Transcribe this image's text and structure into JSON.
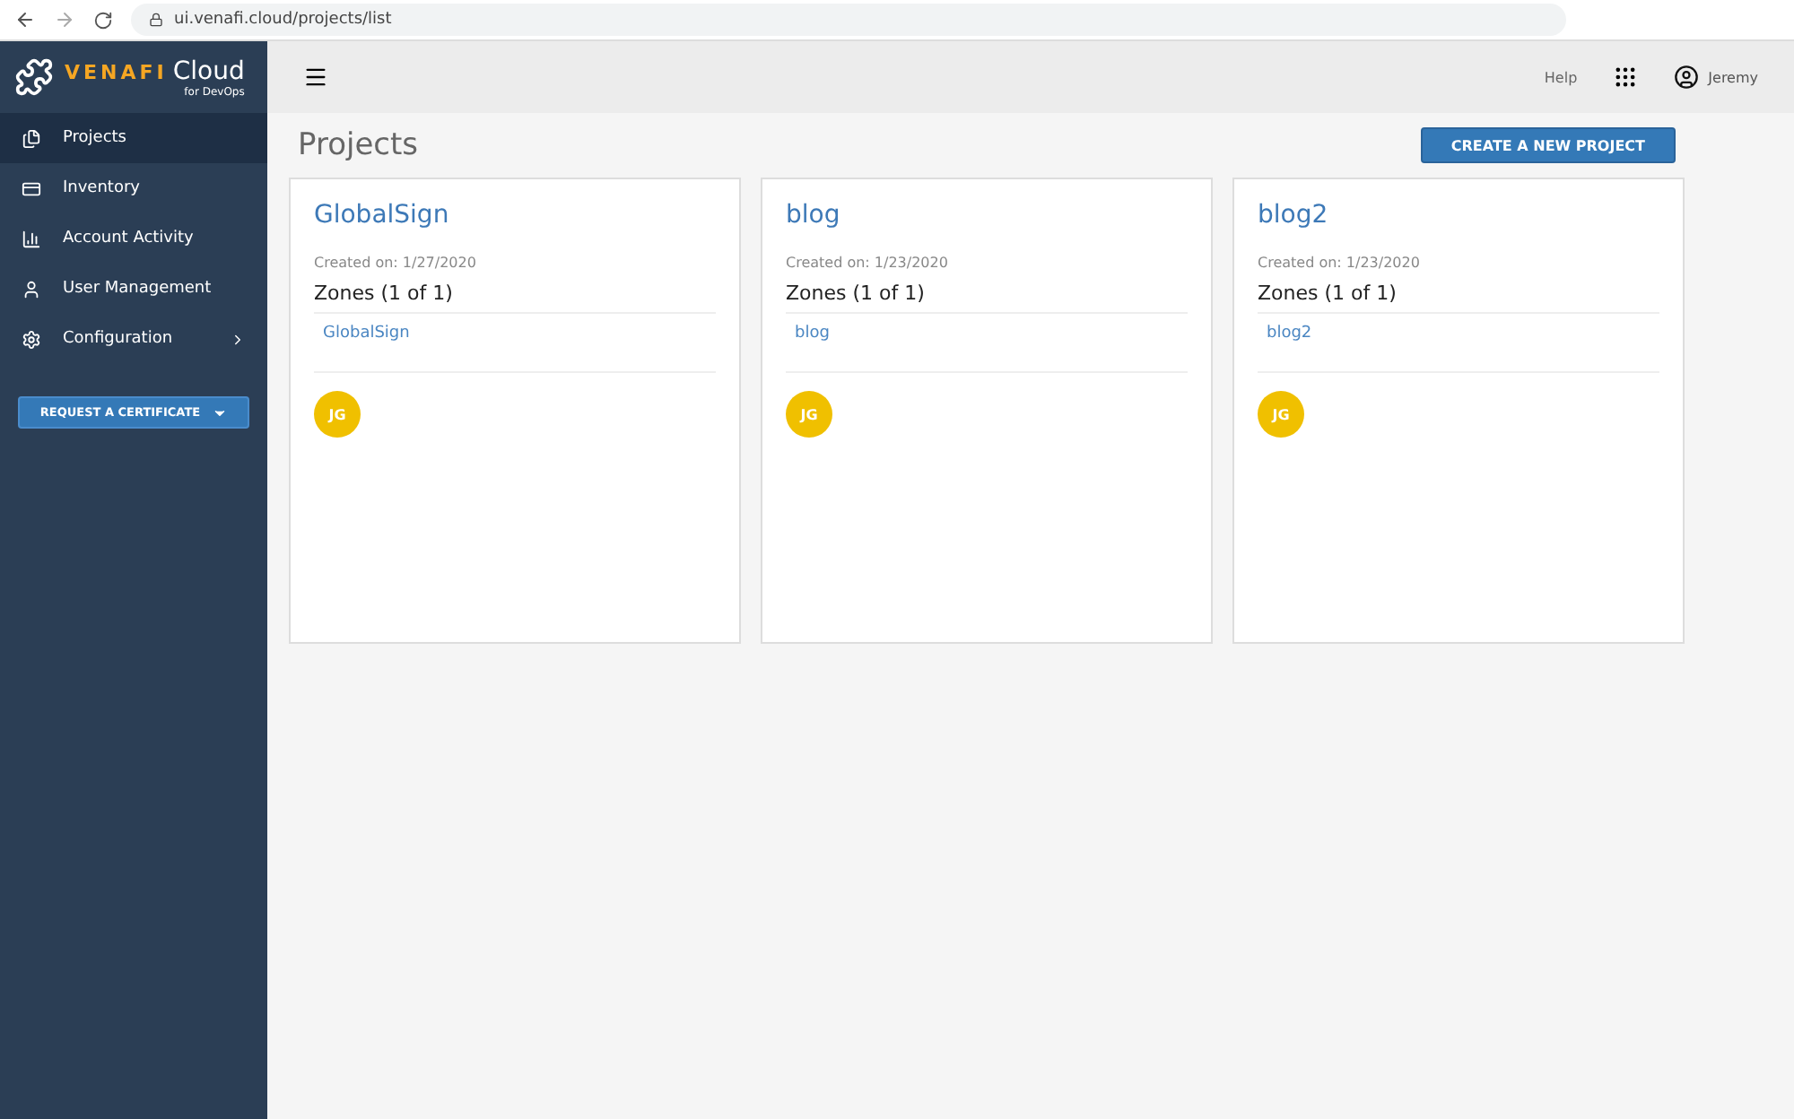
{
  "browser": {
    "url": "ui.venafi.cloud/projects/list"
  },
  "logo": {
    "brand": "VENAFI",
    "product": "Cloud",
    "subtitle": "for DevOps"
  },
  "sidebar": {
    "items": [
      {
        "label": "Projects",
        "selected": true,
        "has_submenu": false
      },
      {
        "label": "Inventory",
        "selected": false,
        "has_submenu": false
      },
      {
        "label": "Account Activity",
        "selected": false,
        "has_submenu": false
      },
      {
        "label": "User Management",
        "selected": false,
        "has_submenu": false
      },
      {
        "label": "Configuration",
        "selected": false,
        "has_submenu": true
      }
    ],
    "request_button": "REQUEST A CERTIFICATE"
  },
  "header": {
    "help": "Help",
    "user": "Jeremy"
  },
  "page": {
    "title": "Projects",
    "create_button": "CREATE A NEW PROJECT"
  },
  "projects": [
    {
      "name": "GlobalSign",
      "created": "Created on: 1/27/2020",
      "zones_heading": "Zones (1 of 1)",
      "zones": [
        "GlobalSign"
      ],
      "members": [
        "JG"
      ]
    },
    {
      "name": "blog",
      "created": "Created on: 1/23/2020",
      "zones_heading": "Zones (1 of 1)",
      "zones": [
        "blog"
      ],
      "members": [
        "JG"
      ]
    },
    {
      "name": "blog2",
      "created": "Created on: 1/23/2020",
      "zones_heading": "Zones (1 of 1)",
      "zones": [
        "blog2"
      ],
      "members": [
        "JG"
      ]
    }
  ]
}
